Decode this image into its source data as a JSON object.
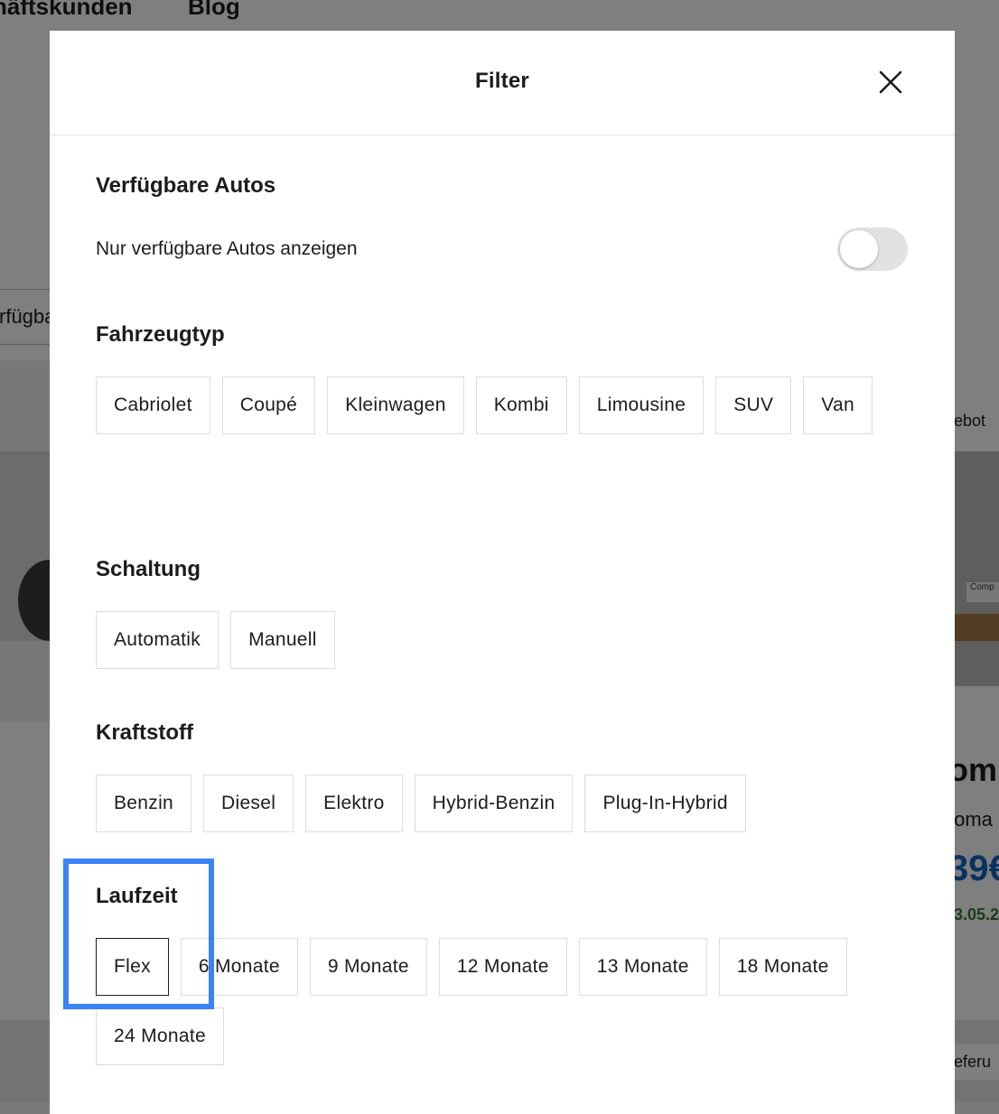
{
  "background": {
    "nav_items": [
      "häftskunden",
      "Blog"
    ],
    "left_chip": "rfügba",
    "right_badge": "ebot",
    "right_model": "om",
    "right_sub": "toma",
    "right_price": "39€",
    "right_date": "3.05.2",
    "right_footer": "eferu",
    "plate_text": "Comp"
  },
  "modal": {
    "title": "Filter",
    "sections": {
      "available": {
        "title": "Verfügbare Autos",
        "toggle_label": "Nur verfügbare Autos anzeigen",
        "toggle_on": false
      },
      "vehicle_type": {
        "title": "Fahrzeugtyp",
        "options": [
          "Cabriolet",
          "Coupé",
          "Kleinwagen",
          "Kombi",
          "Limousine",
          "SUV",
          "Van"
        ]
      },
      "transmission": {
        "title": "Schaltung",
        "options": [
          "Automatik",
          "Manuell"
        ]
      },
      "fuel": {
        "title": "Kraftstoff",
        "options": [
          "Benzin",
          "Diesel",
          "Elektro",
          "Hybrid-Benzin",
          "Plug-In-Hybrid"
        ]
      },
      "duration": {
        "title": "Laufzeit",
        "options": [
          "Flex",
          "6 Monate",
          "9 Monate",
          "12 Monate",
          "13 Monate",
          "18 Monate",
          "24 Monate"
        ],
        "selected": "Flex"
      }
    }
  },
  "colors": {
    "highlight": "#3b82f6",
    "overlay": "rgba(0,0,0,0.5)",
    "price_blue": "#1565c0",
    "date_green": "#2e7d32"
  },
  "icons": {
    "close": "close-icon"
  }
}
